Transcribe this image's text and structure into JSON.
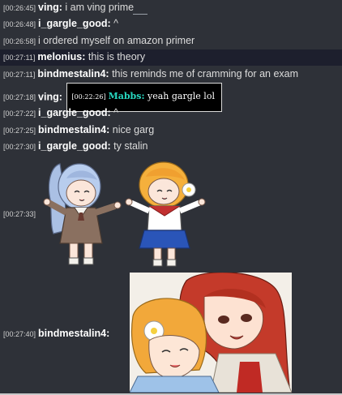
{
  "messages": [
    {
      "ts": "[00:26:45]",
      "user": "ving:",
      "text": "i am ving prime"
    },
    {
      "ts": "[00:26:48]",
      "user": "i_gargle_good:",
      "text": "^"
    },
    {
      "ts": "[00:26:58]",
      "user": "",
      "text": "i ordered myself on amazon primer"
    },
    {
      "ts": "[00:27:11]",
      "user": "melonius:",
      "text": "this is theory"
    },
    {
      "ts": "[00:27:11]",
      "user": "bindmestalin4:",
      "text": "this reminds me of cramming for an exam"
    },
    {
      "ts": "[00:27:18]",
      "user": "ving:",
      "text": ""
    },
    {
      "ts": "[00:27:22]",
      "user": "i_gargle_good:",
      "text": "^"
    },
    {
      "ts": "[00:27:25]",
      "user": "bindmestalin4:",
      "text": "nice garg"
    },
    {
      "ts": "[00:27:30]",
      "user": "i_gargle_good:",
      "text": "ty stalin"
    },
    {
      "ts": "[00:27:33]",
      "user": "",
      "text": ""
    },
    {
      "ts": "[00:27:40]",
      "user": "bindmestalin4:",
      "text": ""
    }
  ],
  "quote": {
    "ts": "[00:22:26]",
    "user": "Mabbs:",
    "text": "yeah gargle lol"
  },
  "colors": {
    "background": "#2e3138",
    "highlight_row": "#1d1f2d",
    "quote_user": "#27d7c0"
  }
}
